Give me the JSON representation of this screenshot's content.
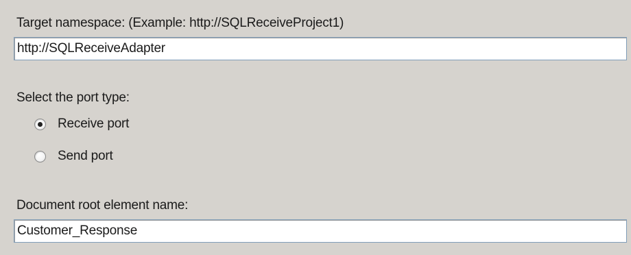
{
  "namespace": {
    "label": "Target namespace: (Example: http://SQLReceiveProject1)",
    "value": "http://SQLReceiveAdapter"
  },
  "port_type": {
    "label": "Select the port type:",
    "options": [
      {
        "label": "Receive port",
        "selected": true
      },
      {
        "label": "Send port",
        "selected": false
      }
    ]
  },
  "root_element": {
    "label": "Document root element name:",
    "value": "Customer_Response"
  },
  "colors": {
    "background": "#d6d3ce",
    "input_border": "#7f9db9"
  },
  "icons": {
    "radio_selected": "radio-selected-icon",
    "radio_unselected": "radio-unselected-icon"
  }
}
